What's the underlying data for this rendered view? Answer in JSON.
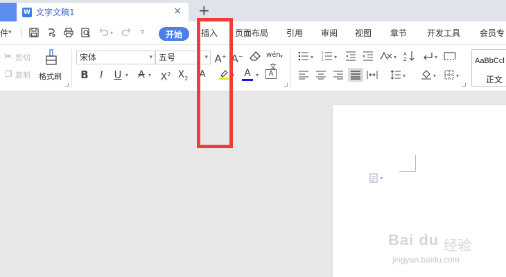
{
  "tabbar": {
    "doc_icon": "W",
    "doc_title": "文字文稿1",
    "close": "×",
    "add": "+"
  },
  "menubar": {
    "file_fragment": "件",
    "file_arrow": "▾",
    "tabs": [
      "开始",
      "插入",
      "页面布局",
      "引用",
      "审阅",
      "视图",
      "章节",
      "开发工具",
      "会员专"
    ]
  },
  "ribbon": {
    "cut": "剪切",
    "copy": "复制",
    "format_painter": "格式刷",
    "font_name": "宋体",
    "font_size": "五号",
    "style_preview": "AaBbCcl",
    "style_name": "正文"
  },
  "watermark": {
    "logo": "Bai du",
    "cn": "经验",
    "url": "jingyan.baidu.com"
  },
  "colors": {
    "accent": "#4f7fe6",
    "highlight": "#f23c3c",
    "highlight_marker": "#f5e400",
    "font_color": "#1a1ad6"
  }
}
